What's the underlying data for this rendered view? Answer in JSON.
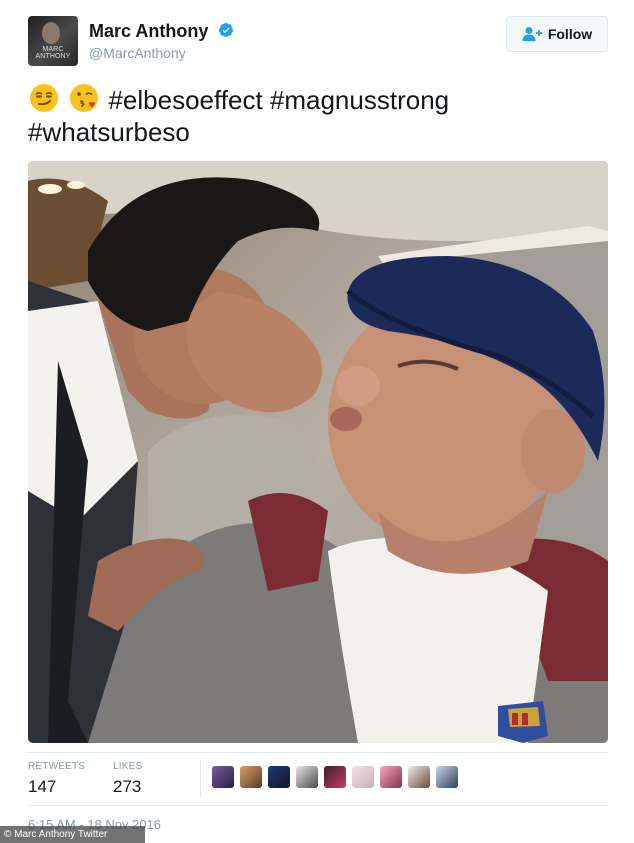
{
  "header": {
    "avatar_text": "MARC ANTHONY",
    "display_name": "Marc Anthony",
    "handle": "@MarcAnthony",
    "verified": true,
    "follow_label": "Follow",
    "follow_icon": "add-user-icon"
  },
  "tweet": {
    "emojis": [
      "smirking-face",
      "face-throwing-kiss"
    ],
    "text_line1": "#elbesoeffect #magnusstrong",
    "text_line2": "#whatsurbeso"
  },
  "stats": {
    "retweets_label": "RETWEETS",
    "retweets_value": "147",
    "likes_label": "LIKES",
    "likes_value": "273",
    "liker_count": 9
  },
  "timestamp": "6:15 AM - 18 Nov 2016",
  "credit": "© Marc Anthony Twitter",
  "colors": {
    "verified": "#1da1f2",
    "muted": "#8899a6",
    "text": "#14171a",
    "border": "#e1e8ed"
  }
}
